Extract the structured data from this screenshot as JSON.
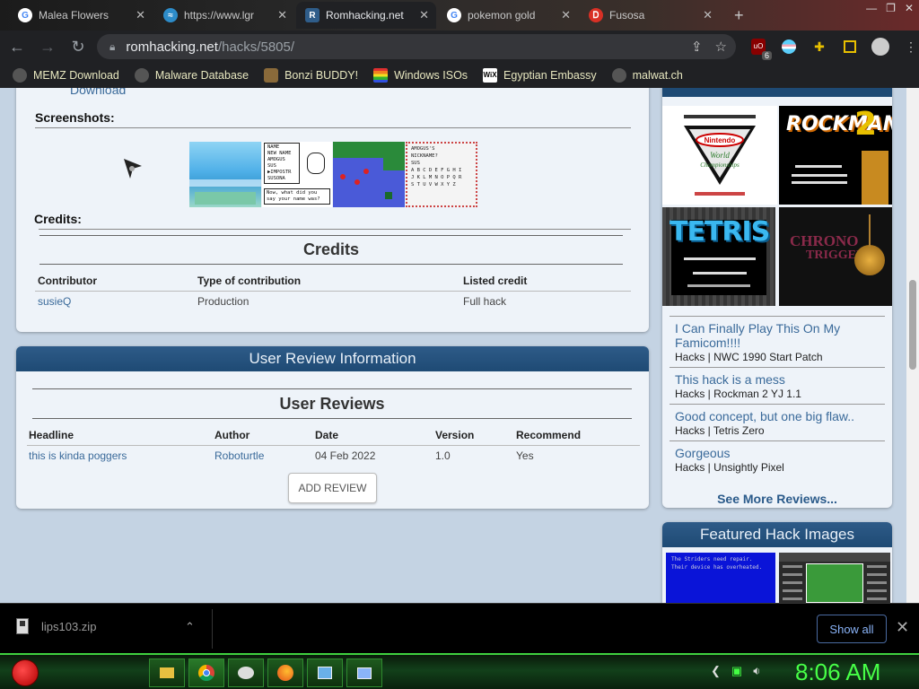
{
  "browser": {
    "tabs": [
      {
        "title": "Malea Flowers",
        "favicon_color": "#4285f4",
        "glyph": "G"
      },
      {
        "title": "https://www.lgr",
        "favicon_color": "#2d8cc9",
        "glyph": "≈"
      },
      {
        "title": "Romhacking.net",
        "favicon_color": "#2f5d8a",
        "glyph": "R"
      },
      {
        "title": "pokemon gold",
        "favicon_color": "#4285f4",
        "glyph": "G"
      },
      {
        "title": "Fusosa",
        "favicon_color": "#d93025",
        "glyph": "Ꭰ"
      }
    ],
    "url_domain": "romhacking.net",
    "url_path": "/hacks/5805/",
    "extension_badge": "6",
    "bookmarks": [
      {
        "label": "MEMZ Download",
        "icon_color": "#555"
      },
      {
        "label": "Malware Database",
        "icon_color": "#555"
      },
      {
        "label": "Bonzi BUDDY!",
        "icon_color": "#8a6a3a"
      },
      {
        "label": "Windows ISOs",
        "icon_color": "#e03030"
      },
      {
        "label": "Egyptian Embassy",
        "icon_color": "#ffffff"
      },
      {
        "label": "malwat.ch",
        "icon_color": "#555"
      }
    ]
  },
  "main": {
    "download_link_partial": "Download",
    "screenshots_label": "Screenshots:",
    "screenshots": [
      {
        "name": "beach-screen",
        "bg": "#4fb0e8"
      },
      {
        "name": "name-entry-screen",
        "bg": "#ffffff",
        "lines": [
          "NAME",
          "NEW NAME",
          "AMOGUS",
          "SUS",
          "▶IMPOSTR",
          "SUSONA",
          "Now, what did you say your name was?"
        ]
      },
      {
        "name": "map-screen",
        "bg": "#4a5ad8"
      },
      {
        "name": "nickname-screen",
        "bg": "#f4f4f4",
        "lines": [
          "AMOGUS'S",
          "NICKNAME?",
          "SUS",
          "A B C D E F G H I",
          "J K L M N O P Q R",
          "S T U V W X Y Z"
        ]
      }
    ],
    "credits_label": "Credits:",
    "credits_title": "Credits",
    "credits_headers": [
      "Contributor",
      "Type of contribution",
      "Listed credit"
    ],
    "credits_rows": [
      [
        "susieQ",
        "Production",
        "Full hack"
      ]
    ]
  },
  "reviews": {
    "section_title": "User Review Information",
    "table_title": "User Reviews",
    "headers": [
      "Headline",
      "Author",
      "Date",
      "Version",
      "Recommend"
    ],
    "rows": [
      [
        "this is kinda poggers",
        "Roboturtle",
        "04 Feb 2022",
        "1.0",
        "Yes"
      ]
    ],
    "add_button": "ADD REVIEW"
  },
  "sidebar": {
    "thumbs": [
      {
        "name": "nwc-thumb",
        "title": "Nintendo World Championships",
        "bg": "#ffffff"
      },
      {
        "name": "rockman-thumb",
        "title": "ROCKMAN 2",
        "bg": "#000000"
      },
      {
        "name": "tetris-thumb",
        "title": "TETRIS",
        "bg": "#2a2a2a"
      },
      {
        "name": "chrono-thumb",
        "title": "CHRONO TRIGGER",
        "bg": "#111111"
      }
    ],
    "recent_reviews": [
      {
        "title": "I Can Finally Play This On My Famicom!!!!",
        "meta": "Hacks | NWC 1990 Start Patch"
      },
      {
        "title": "This hack is a mess",
        "meta": "Hacks | Rockman 2 YJ 1.1"
      },
      {
        "title": "Good concept, but one big flaw..",
        "meta": "Hacks | Tetris Zero"
      },
      {
        "title": "Gorgeous",
        "meta": "Hacks | Unsightly Pixel"
      }
    ],
    "see_more": "See More Reviews...",
    "featured_title": "Featured Hack Images",
    "featured_text": "The Striders need repair. Their device has overheated."
  },
  "downloads": {
    "file_name": "lips103.zip",
    "show_all": "Show all"
  },
  "taskbar": {
    "clock": "8:06 AM"
  },
  "colors": {
    "link": "#3a6a9a",
    "header_blue": "#1e4a74",
    "page_bg": "#c4d3e3",
    "clock_green": "#47ff47"
  }
}
